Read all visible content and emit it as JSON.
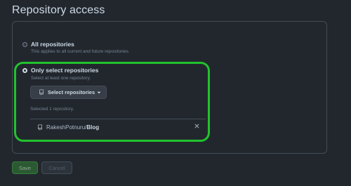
{
  "page": {
    "title": "Repository access"
  },
  "options": {
    "all": {
      "label": "All repositories",
      "help": "This applies to all current and future repositories.",
      "selected": false
    },
    "select": {
      "label": "Only select repositories",
      "help": "Select at least one repository.",
      "selected": true,
      "button_label": "Select repositories",
      "selected_count_text": "Selected 1 repository.",
      "repos": [
        {
          "owner": "RakeshPotnuru",
          "name": "Blog"
        }
      ]
    }
  },
  "actions": {
    "save_label": "Save",
    "cancel_label": "Cancel"
  },
  "colors": {
    "highlight": "#22c22e",
    "background": "#22272e",
    "save_button": "#2b5a32"
  },
  "icons": {
    "repo": "repo-icon",
    "caret": "caret-down-icon",
    "remove": "close-icon"
  }
}
